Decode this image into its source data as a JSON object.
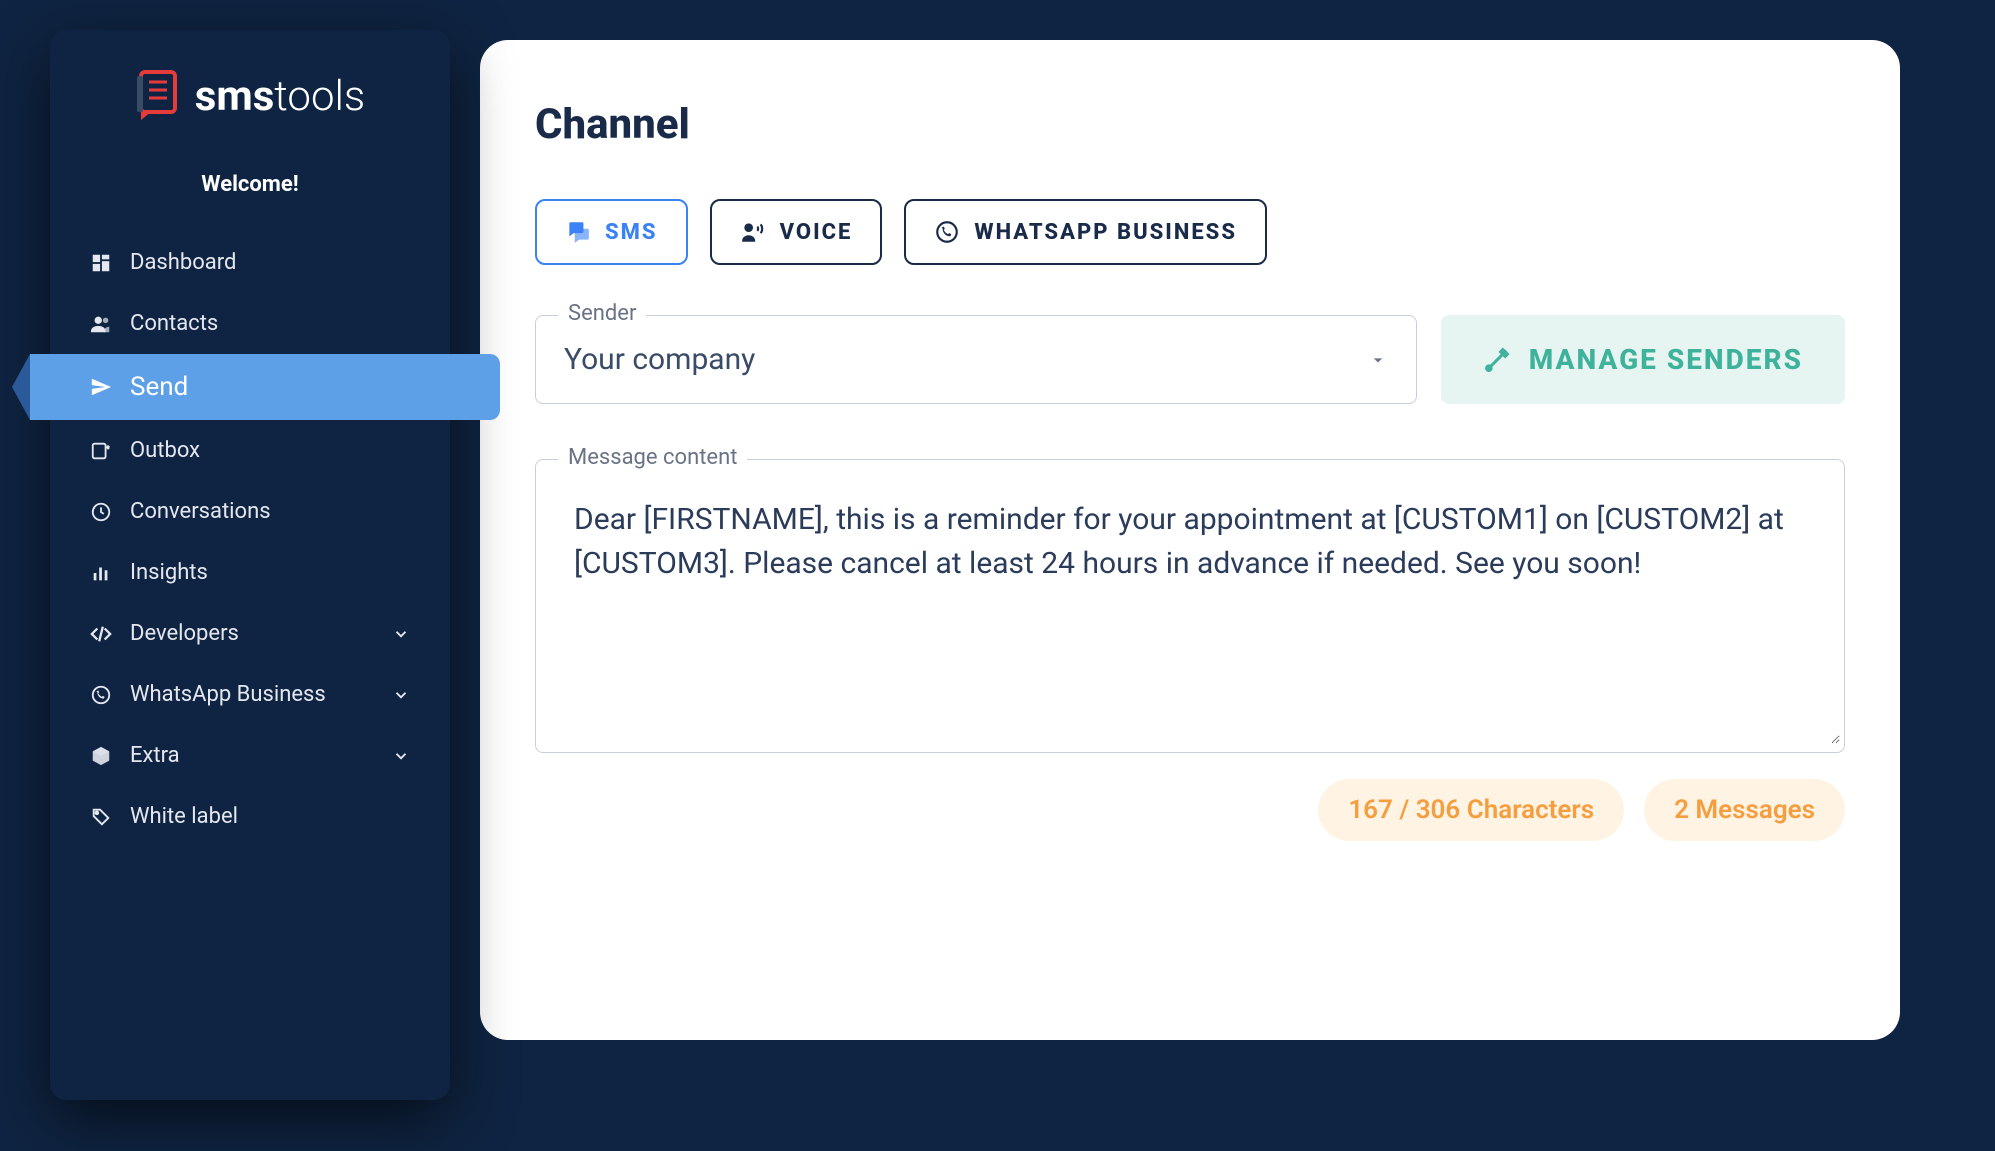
{
  "logo": {
    "text_prefix": "sms",
    "text_suffix": "tools"
  },
  "sidebar": {
    "welcome": "Welcome!",
    "items": [
      {
        "label": "Dashboard",
        "icon": "dashboard-icon",
        "active": false,
        "hasChevron": false
      },
      {
        "label": "Contacts",
        "icon": "contacts-icon",
        "active": false,
        "hasChevron": false
      },
      {
        "label": "Send",
        "icon": "send-icon",
        "active": true,
        "hasChevron": false
      },
      {
        "label": "Outbox",
        "icon": "outbox-icon",
        "active": false,
        "hasChevron": false
      },
      {
        "label": "Conversations",
        "icon": "history-icon",
        "active": false,
        "hasChevron": false
      },
      {
        "label": "Insights",
        "icon": "insights-icon",
        "active": false,
        "hasChevron": false
      },
      {
        "label": "Developers",
        "icon": "code-icon",
        "active": false,
        "hasChevron": true
      },
      {
        "label": "WhatsApp Business",
        "icon": "whatsapp-icon",
        "active": false,
        "hasChevron": true
      },
      {
        "label": "Extra",
        "icon": "extra-icon",
        "active": false,
        "hasChevron": true
      },
      {
        "label": "White label",
        "icon": "whitelabel-icon",
        "active": false,
        "hasChevron": false
      }
    ]
  },
  "main": {
    "title": "Channel",
    "tabs": [
      {
        "label": "SMS",
        "active": true
      },
      {
        "label": "VOICE",
        "active": false
      },
      {
        "label": "WHATSAPP BUSINESS",
        "active": false
      }
    ],
    "sender": {
      "legend": "Sender",
      "value": "Your company"
    },
    "manage_label": "MANAGE SENDERS",
    "message": {
      "legend": "Message content",
      "value": "Dear [FIRSTNAME], this is a reminder for your appointment at [CUSTOM1] on [CUSTOM2] at [CUSTOM3]. Please cancel at least 24 hours in advance if needed. See you soon!"
    },
    "counts": {
      "chars": "167 / 306 Characters",
      "messages": "2 Messages"
    }
  }
}
